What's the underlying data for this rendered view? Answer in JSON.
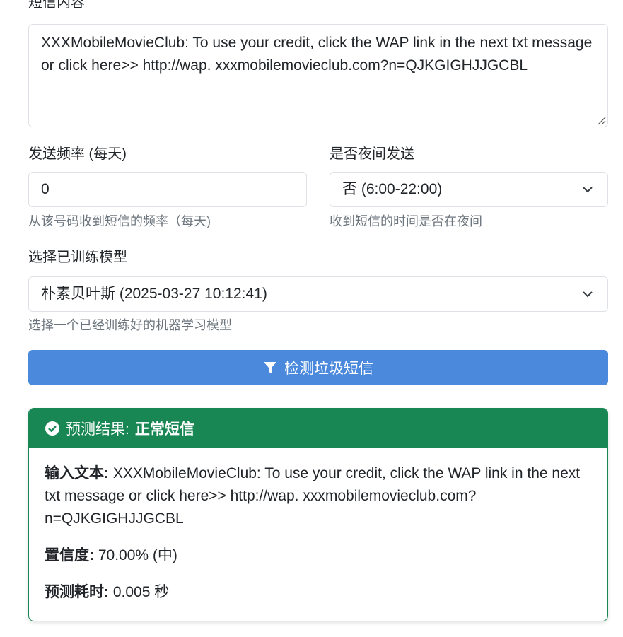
{
  "form": {
    "sms_content_label": "短信内容",
    "sms_content_value": "XXXMobileMovieClub: To use your credit, click the WAP link in the next txt message or click here>> http://wap. xxxmobilemovieclub.com?n=QJKGIGHJJGCBL",
    "frequency_label": "发送频率 (每天)",
    "frequency_value": "0",
    "frequency_help": "从该号码收到短信的频率（每天)",
    "night_label": "是否夜间发送",
    "night_value": "否 (6:00-22:00)",
    "night_help": "收到短信的时间是否在夜间",
    "model_label": "选择已训练模型",
    "model_value": "朴素贝叶斯 (2025-03-27 10:12:41)",
    "model_help": "选择一个已经训练好的机器学习模型",
    "detect_button": "检测垃圾短信"
  },
  "result": {
    "header_prefix": "预测结果:",
    "header_value": "正常短信",
    "input_text_label": "输入文本:",
    "input_text_value": "XXXMobileMovieClub: To use your credit, click the WAP link in the next txt message or click here>> http://wap. xxxmobilemovieclub.com?n=QJKGIGHJJGCBL",
    "confidence_label": "置信度:",
    "confidence_value": "70.00% (中)",
    "time_label": "预测耗时:",
    "time_value": "0.005 秒"
  },
  "colors": {
    "primary_button": "#4a89dc",
    "success": "#198754"
  },
  "icons": [
    "filter-icon",
    "check-circle-icon",
    "chevron-down-icon",
    "resize-grip-icon"
  ]
}
